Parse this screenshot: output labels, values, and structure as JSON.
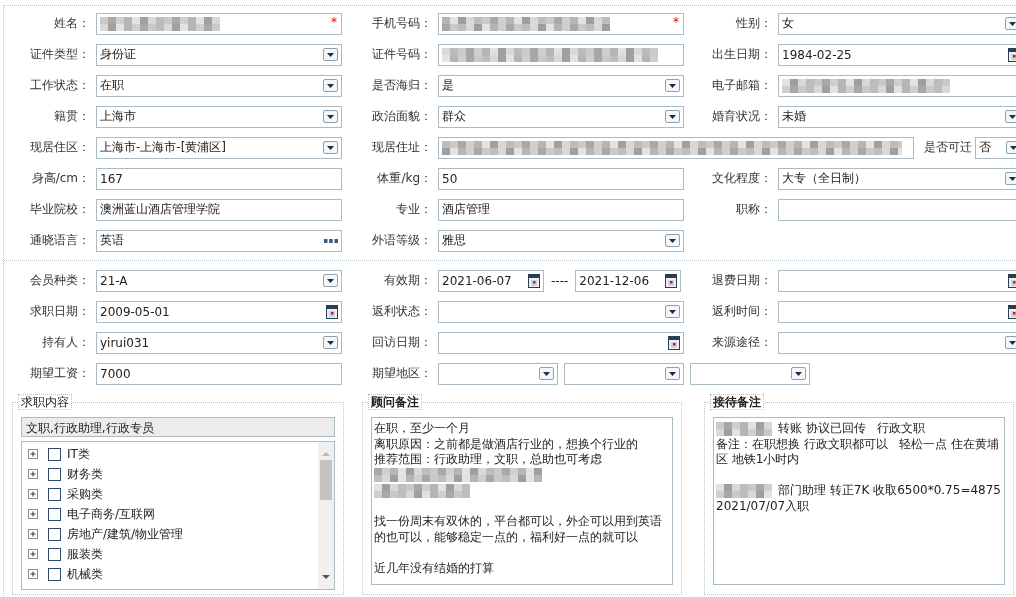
{
  "sections": [
    {
      "rows": [
        {
          "groups": [
            {
              "kind": "standard",
              "label": "姓名：",
              "fields": [
                {
                  "kind": "text",
                  "blurred": true,
                  "required_mark": "*"
                }
              ]
            },
            {
              "kind": "standard",
              "label": "手机号码：",
              "fields": [
                {
                  "kind": "text",
                  "blurred": true,
                  "required_mark": "*"
                }
              ]
            },
            {
              "kind": "standard",
              "label": "性别：",
              "fields": [
                {
                  "kind": "select",
                  "value": "女"
                }
              ]
            }
          ]
        },
        {
          "groups": [
            {
              "kind": "standard",
              "label": "证件类型：",
              "fields": [
                {
                  "kind": "select",
                  "value": "身份证"
                }
              ]
            },
            {
              "kind": "standard",
              "label": "证件号码：",
              "fields": [
                {
                  "kind": "text",
                  "blurred": true
                }
              ]
            },
            {
              "kind": "standard",
              "label": "出生日期：",
              "fields": [
                {
                  "kind": "date",
                  "value": "1984-02-25"
                }
              ]
            }
          ]
        },
        {
          "groups": [
            {
              "kind": "standard",
              "label": "工作状态：",
              "fields": [
                {
                  "kind": "select",
                  "value": "在职"
                }
              ]
            },
            {
              "kind": "standard",
              "label": "是否海归：",
              "fields": [
                {
                  "kind": "select",
                  "value": "是"
                }
              ]
            },
            {
              "kind": "standard",
              "label": "电子邮箱：",
              "fields": [
                {
                  "kind": "text",
                  "blurred": true
                }
              ]
            }
          ]
        },
        {
          "groups": [
            {
              "kind": "standard",
              "label": "籍贯：",
              "fields": [
                {
                  "kind": "select",
                  "value": "上海市"
                }
              ]
            },
            {
              "kind": "standard",
              "label": "政治面貌：",
              "fields": [
                {
                  "kind": "select",
                  "value": "群众"
                }
              ]
            },
            {
              "kind": "standard",
              "label": "婚育状况：",
              "fields": [
                {
                  "kind": "select",
                  "value": "未婚"
                }
              ]
            }
          ]
        },
        {
          "groups": [
            {
              "kind": "standard",
              "label": "现居住区：",
              "fields": [
                {
                  "kind": "select",
                  "value": "上海市-上海市-[黄浦区]"
                }
              ]
            },
            {
              "kind": "wide",
              "label": "现居住址：",
              "fields": [
                {
                  "kind": "text",
                  "blurred": true
                }
              ]
            },
            {
              "kind": "compact",
              "label": "是否可迁",
              "fields": [
                {
                  "kind": "select",
                  "value": "否"
                }
              ]
            }
          ]
        },
        {
          "groups": [
            {
              "kind": "standard",
              "label": "身高/cm：",
              "fields": [
                {
                  "kind": "text",
                  "value": "167"
                }
              ]
            },
            {
              "kind": "standard",
              "label": "体重/kg：",
              "fields": [
                {
                  "kind": "text",
                  "value": "50"
                }
              ]
            },
            {
              "kind": "standard",
              "label": "文化程度：",
              "fields": [
                {
                  "kind": "select",
                  "value": "大专（全日制）"
                }
              ]
            }
          ]
        },
        {
          "groups": [
            {
              "kind": "standard",
              "label": "毕业院校：",
              "fields": [
                {
                  "kind": "text",
                  "value": "澳洲蓝山酒店管理学院"
                }
              ]
            },
            {
              "kind": "standard",
              "label": "专业：",
              "fields": [
                {
                  "kind": "text",
                  "value": "酒店管理"
                }
              ]
            },
            {
              "kind": "standard",
              "label": "职称：",
              "fields": [
                {
                  "kind": "text"
                }
              ]
            }
          ]
        },
        {
          "groups": [
            {
              "kind": "standard",
              "label": "通晓语言：",
              "fields": [
                {
                  "kind": "picker",
                  "value": "英语"
                }
              ]
            },
            {
              "kind": "standard",
              "label": "外语等级：",
              "fields": [
                {
                  "kind": "select",
                  "value": "雅思"
                }
              ]
            }
          ]
        }
      ]
    },
    {
      "rows": [
        {
          "groups": [
            {
              "kind": "standard",
              "label": "会员种类：",
              "fields": [
                {
                  "kind": "select",
                  "value": "21-A"
                }
              ]
            },
            {
              "kind": "standard",
              "label": "有效期：",
              "fields": [
                {
                  "kind": "date",
                  "value": "2021-06-07"
                },
                {
                  "kind": "separator",
                  "value": "----"
                },
                {
                  "kind": "date",
                  "value": "2021-12-06"
                }
              ]
            },
            {
              "kind": "standard",
              "label": "退费日期：",
              "fields": [
                {
                  "kind": "date"
                }
              ]
            }
          ]
        },
        {
          "groups": [
            {
              "kind": "standard",
              "label": "求职日期：",
              "fields": [
                {
                  "kind": "date",
                  "value": "2009-05-01"
                }
              ]
            },
            {
              "kind": "standard",
              "label": "返利状态：",
              "fields": [
                {
                  "kind": "select"
                }
              ]
            },
            {
              "kind": "standard",
              "label": "返利时间：",
              "fields": [
                {
                  "kind": "date"
                }
              ]
            }
          ]
        },
        {
          "groups": [
            {
              "kind": "standard",
              "label": "持有人：",
              "fields": [
                {
                  "kind": "select",
                  "value": "yirui031"
                }
              ]
            },
            {
              "kind": "standard",
              "label": "回访日期：",
              "fields": [
                {
                  "kind": "date"
                }
              ]
            },
            {
              "kind": "standard",
              "label": "来源途径：",
              "fields": [
                {
                  "kind": "select"
                }
              ]
            }
          ]
        },
        {
          "groups": [
            {
              "kind": "standard",
              "label": "期望工资：",
              "fields": [
                {
                  "kind": "text",
                  "value": "7000"
                }
              ]
            },
            {
              "kind": "standard",
              "label": "期望地区：",
              "fields": [
                {
                  "kind": "select"
                },
                {
                  "kind": "select"
                },
                {
                  "kind": "select"
                }
              ]
            }
          ]
        }
      ]
    }
  ],
  "panels": [
    {
      "kind": "tree",
      "legend": "求职内容",
      "emphasized": false,
      "summary": "文职,行政助理,行政专员",
      "items": [
        {
          "label": "IT类",
          "checked": false,
          "expanded": false
        },
        {
          "label": "财务类",
          "checked": false,
          "expanded": false
        },
        {
          "label": "采购类",
          "checked": false,
          "expanded": false
        },
        {
          "label": "电子商务/互联网",
          "checked": false,
          "expanded": false
        },
        {
          "label": "房地产/建筑/物业管理",
          "checked": false,
          "expanded": false
        },
        {
          "label": "服装类",
          "checked": false,
          "expanded": false
        },
        {
          "label": "机械类",
          "checked": false,
          "expanded": false
        }
      ]
    },
    {
      "kind": "notes",
      "legend": "顾问备注",
      "emphasized": true,
      "lines": [
        {
          "kind": "text",
          "text": "在职，至少一个月"
        },
        {
          "kind": "text",
          "text": "离职原因：之前都是做酒店行业的，想换个行业的"
        },
        {
          "kind": "text",
          "text": "推荐范围：行政助理，文职，总助也可考虑"
        },
        {
          "kind": "blurred"
        },
        {
          "kind": "blurred"
        },
        {
          "kind": "blank"
        },
        {
          "kind": "text",
          "text": "找一份周末有双休的，平台都可以，外企可以用到英语"
        },
        {
          "kind": "text",
          "text": "的也可以，能够稳定一点的，福利好一点的就可以"
        },
        {
          "kind": "blank"
        },
        {
          "kind": "text",
          "text": "近几年没有结婚的打算"
        }
      ]
    },
    {
      "kind": "notes",
      "legend": "接待备注",
      "emphasized": true,
      "lines": [
        {
          "kind": "text",
          "blurred_prefix": true,
          "text": "转账 协议已回传   行政文职"
        },
        {
          "kind": "text",
          "text": "备注：在职想换 行政文职都可以   轻松一点 住在黄埔"
        },
        {
          "kind": "text",
          "text": "区 地铁1小时内"
        },
        {
          "kind": "blank"
        },
        {
          "kind": "text",
          "blurred_prefix": true,
          "text": "部门助理 转正7K 收取6500*0.75=4875"
        },
        {
          "kind": "text",
          "text": "2021/07/07入职"
        }
      ]
    }
  ]
}
